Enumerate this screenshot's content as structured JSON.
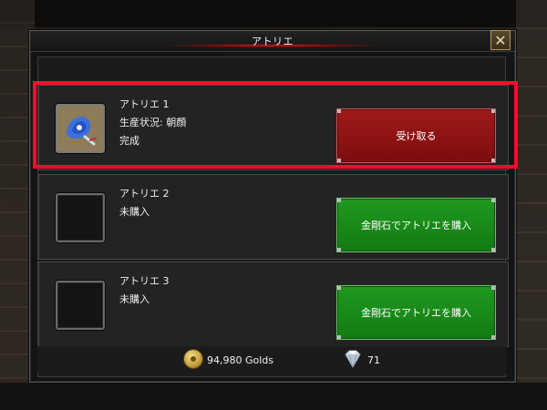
{
  "window": {
    "title": "アトリエ",
    "close_symbol": "✕"
  },
  "slots": [
    {
      "name": "アトリエ 1",
      "status_label": "生産状況: 朝顔",
      "state": "完成",
      "icon": "morning-glory-icon",
      "button_label": "受け取る",
      "button_color": "#8c1212",
      "highlighted": true
    },
    {
      "name": "アトリエ 2",
      "status_label": "未購入",
      "state": "",
      "icon": "",
      "button_label": "金剛石でアトリエを購入",
      "button_color": "#1a8a1a",
      "highlighted": false
    },
    {
      "name": "アトリエ 3",
      "status_label": "未購入",
      "state": "",
      "icon": "",
      "button_label": "金剛石でアトリエを購入",
      "button_color": "#1a8a1a",
      "highlighted": false
    }
  ],
  "currency": {
    "gold_icon": "gold-coin-icon",
    "gold_text": "94,980 Golds",
    "diamond_icon": "diamond-icon",
    "diamond_text": "71"
  },
  "colors": {
    "highlight_border": "#ff0a2a",
    "title_glow": "#c02020"
  }
}
